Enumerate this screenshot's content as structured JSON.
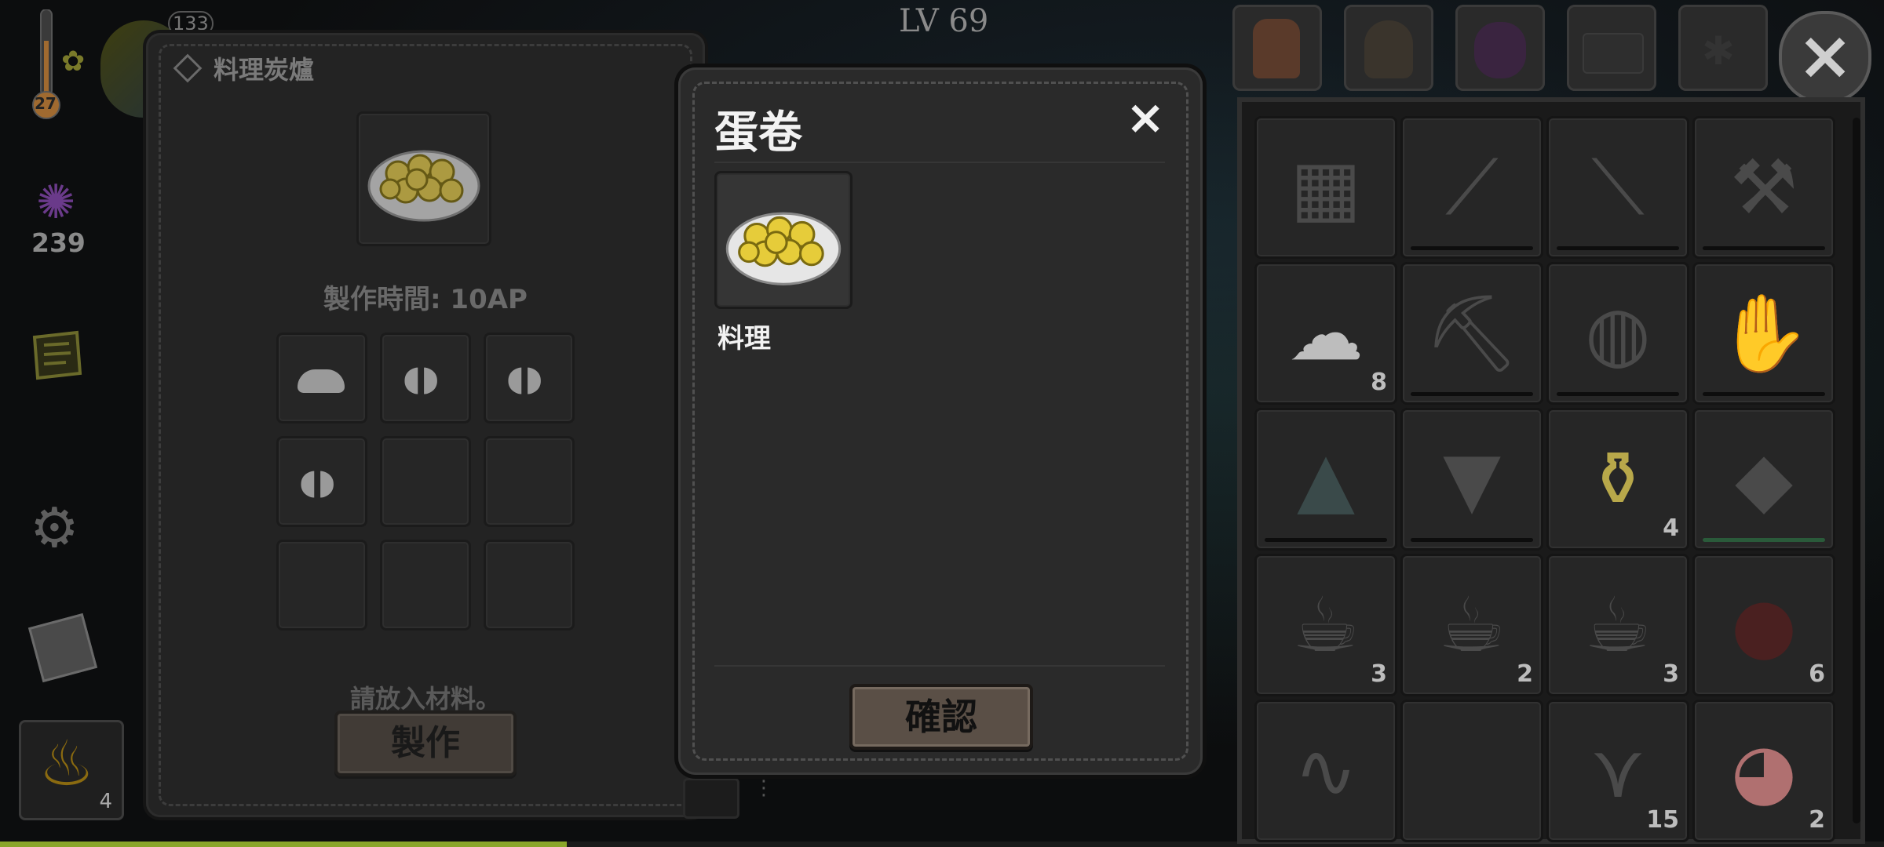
{
  "hud": {
    "level": "LV 69",
    "temperature": "27",
    "sanity": "239",
    "top_counter": "133",
    "fuel_count": "4"
  },
  "crafting_panel": {
    "title": "料理炭爐",
    "craft_time": "製作時間: 10AP",
    "hint": "請放入材料。",
    "craft_button": "製作",
    "ingredients": [
      {
        "icon": "flour-icon"
      },
      {
        "icon": "eggs-icon"
      },
      {
        "icon": "eggs-icon"
      },
      {
        "icon": "eggs-icon"
      },
      {
        "icon": ""
      },
      {
        "icon": ""
      },
      {
        "icon": ""
      },
      {
        "icon": ""
      },
      {
        "icon": ""
      }
    ]
  },
  "dialog": {
    "title": "蛋卷",
    "close": "×",
    "category": "料理",
    "confirm": "確認"
  },
  "inventory": {
    "tabs": [
      "backpack-icon",
      "sack-icon",
      "purple-bag-icon",
      "chest-icon",
      "spider-icon"
    ],
    "close": "×",
    "items": [
      {
        "name": "map-icon",
        "count": ""
      },
      {
        "name": "knife-icon",
        "count": ""
      },
      {
        "name": "shovel-icon",
        "count": ""
      },
      {
        "name": "axe-icon",
        "count": ""
      },
      {
        "name": "flour-icon",
        "count": "8"
      },
      {
        "name": "pickaxe-icon",
        "count": ""
      },
      {
        "name": "helmet-icon",
        "count": ""
      },
      {
        "name": "glove-icon",
        "count": ""
      },
      {
        "name": "cloak-icon",
        "count": ""
      },
      {
        "name": "skirt-icon",
        "count": ""
      },
      {
        "name": "oil-bottle-icon",
        "count": "4"
      },
      {
        "name": "bread-icon",
        "count": ""
      },
      {
        "name": "cup-icon",
        "count": "3"
      },
      {
        "name": "cup-icon",
        "count": "2"
      },
      {
        "name": "cup-icon",
        "count": "3"
      },
      {
        "name": "berry-icon",
        "count": "6"
      },
      {
        "name": "worm-icon",
        "count": ""
      },
      {
        "name": "empty",
        "count": ""
      },
      {
        "name": "branch-icon",
        "count": "15"
      },
      {
        "name": "meat-icon",
        "count": "2"
      }
    ]
  },
  "colors": {
    "panel": "#232323",
    "wood_button": "#5a4f46",
    "xp_bar": "#8aa62a",
    "sanity": "#6a3a8a"
  }
}
